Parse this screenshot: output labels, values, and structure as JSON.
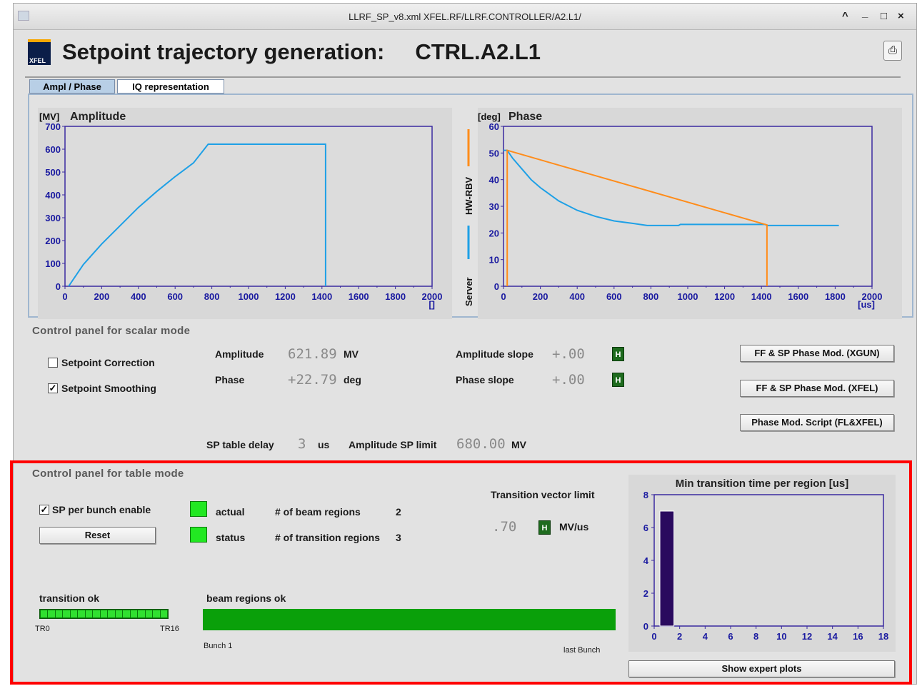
{
  "window": {
    "title": "LLRF_SP_v8.xml   XFEL.RF/LLRF.CONTROLLER/A2.L1/",
    "controls": [
      "^",
      "_",
      "□",
      "×"
    ]
  },
  "header": {
    "logo_text": "XFEL",
    "title": "Setpoint trajectory generation:     CTRL.A2.L1",
    "print_icon": "printer-icon"
  },
  "tabs": [
    {
      "label": "Ampl / Phase",
      "selected": true
    },
    {
      "label": "IQ representation",
      "selected": false
    }
  ],
  "legend": {
    "hw": "HW-RBV",
    "server": "Server",
    "hw_color": "#ff8c1a",
    "server_color": "#1ea0e6"
  },
  "chart_data": [
    {
      "type": "line",
      "title": "Amplitude",
      "ylabel": "[MV]",
      "xlabel": "[]",
      "xlim": [
        0,
        2000
      ],
      "ylim": [
        0,
        700
      ],
      "xticks": [
        0,
        200,
        400,
        600,
        800,
        1000,
        1200,
        1400,
        1600,
        1800,
        2000
      ],
      "yticks": [
        0,
        100,
        200,
        300,
        400,
        500,
        600,
        700
      ],
      "series": [
        {
          "name": "Server",
          "color": "#1ea0e6",
          "x": [
            20,
            100,
            200,
            300,
            400,
            500,
            600,
            700,
            780,
            1420,
            1420
          ],
          "y": [
            0,
            95,
            185,
            265,
            345,
            415,
            480,
            540,
            621.89,
            621.89,
            0
          ]
        }
      ]
    },
    {
      "type": "line",
      "title": "Phase",
      "ylabel": "[deg]",
      "xlabel": "[us]",
      "xlim": [
        0,
        2000
      ],
      "ylim": [
        0,
        60
      ],
      "xticks": [
        0,
        200,
        400,
        600,
        800,
        1000,
        1200,
        1400,
        1600,
        1800,
        2000
      ],
      "yticks": [
        0,
        10,
        20,
        30,
        40,
        50,
        60
      ],
      "series": [
        {
          "name": "Server",
          "color": "#1ea0e6",
          "x": [
            0,
            20,
            50,
            100,
            150,
            200,
            300,
            400,
            500,
            600,
            700,
            780,
            950,
            960,
            1420,
            1430,
            1820
          ],
          "y": [
            51,
            51,
            48,
            44,
            40,
            37,
            32,
            28.5,
            26.2,
            24.5,
            23.6,
            22.8,
            22.8,
            23.2,
            23.2,
            22.8,
            22.8
          ]
        },
        {
          "name": "HW-RBV",
          "color": "#ff8c1a",
          "x": [
            20,
            20,
            1430,
            1430
          ],
          "y": [
            0,
            51,
            23,
            0
          ]
        }
      ]
    },
    {
      "type": "bar",
      "title": "Min transition time per region [us]",
      "xlim": [
        0,
        18
      ],
      "ylim": [
        0,
        8
      ],
      "xticks": [
        0,
        2,
        4,
        6,
        8,
        10,
        12,
        14,
        16,
        18
      ],
      "yticks": [
        0,
        2,
        4,
        6,
        8
      ],
      "x": [
        1
      ],
      "values": [
        7
      ],
      "color": "#2a0a5e"
    }
  ],
  "scalar_panel": {
    "title": "Control panel for scalar mode",
    "setpoint_correction": {
      "label": "Setpoint Correction",
      "checked": false
    },
    "setpoint_smoothing": {
      "label": "Setpoint Smoothing",
      "checked": true
    },
    "amplitude": {
      "label": "Amplitude",
      "value": "621.89",
      "unit": "MV"
    },
    "phase": {
      "label": "Phase",
      "value": "+22.79",
      "unit": "deg"
    },
    "amplitude_slope": {
      "label": "Amplitude slope",
      "value": "+.00",
      "h": "H"
    },
    "phase_slope": {
      "label": "Phase slope",
      "value": "+.00",
      "h": "H"
    },
    "btn_xgun": "FF & SP Phase Mod. (XGUN)",
    "btn_xfel": "FF & SP Phase Mod. (XFEL)",
    "btn_script": "Phase Mod. Script (FL&XFEL)",
    "sp_table_delay": {
      "label": "SP table delay",
      "value": "3",
      "unit": "us"
    },
    "amp_sp_limit": {
      "label": "Amplitude SP limit",
      "value": "680.00",
      "unit": "MV"
    }
  },
  "table_panel": {
    "title": "Control panel for table mode",
    "sp_per_bunch": {
      "label": "SP per bunch enable",
      "checked": true
    },
    "reset": "Reset",
    "actual": "actual",
    "status": "status",
    "beam_regions_label": "# of beam regions",
    "beam_regions_value": "2",
    "transition_regions_label": "# of transition regions",
    "transition_regions_value": "3",
    "transition_vector_limit": {
      "label": "Transition vector limit",
      "value": ".70",
      "h": "H",
      "unit": "MV/us"
    },
    "transition_ok": "transition ok",
    "tr_start": "TR0",
    "tr_end": "TR16",
    "beam_regions_ok": "beam regions ok",
    "bunch_first": "Bunch 1",
    "bunch_last": "last Bunch",
    "show_expert": "Show expert plots"
  }
}
